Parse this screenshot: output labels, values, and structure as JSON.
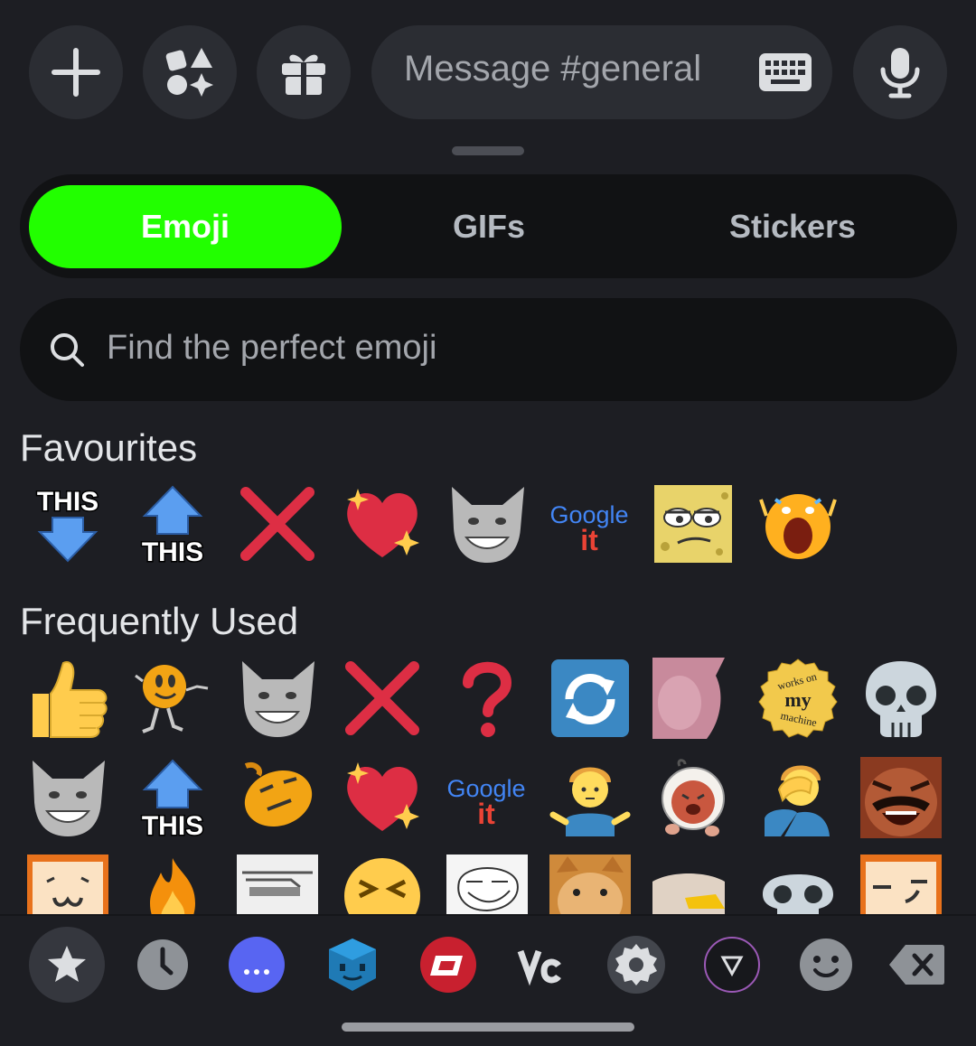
{
  "message_bar": {
    "placeholder": "Message #general"
  },
  "tabs": [
    {
      "label": "Emoji",
      "active": true
    },
    {
      "label": "GIFs"
    },
    {
      "label": "Stickers"
    }
  ],
  "search": {
    "placeholder": "Find the perfect emoji"
  },
  "sections": {
    "favourites": "Favourites",
    "frequently_used": "Frequently Used"
  },
  "emoji_text": {
    "this": "THIS",
    "google": "Google",
    "it": "it",
    "works_on": "works on",
    "my": "my",
    "machine": "machine"
  },
  "colors": {
    "accent": "#22ff00",
    "background": "#1d1e23",
    "input_bg": "#2b2d33",
    "red_x": "#dd2e44",
    "blurple": "#5865f2"
  },
  "bottom_categories": [
    "favourites-star",
    "recent-clock",
    "server-dots",
    "server-blue-cube",
    "server-red-logo",
    "server-vc",
    "server-gear",
    "server-v-triangle",
    "people-smile",
    "backspace"
  ]
}
